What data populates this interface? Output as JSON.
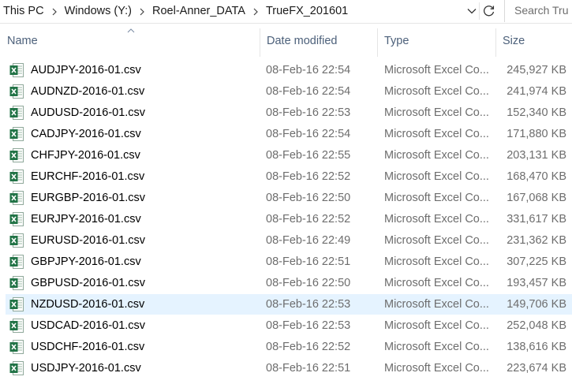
{
  "address_bar": {
    "crumbs": [
      "This PC",
      "Windows (Y:)",
      "Roel-Anner_DATA",
      "TrueFX_201601"
    ]
  },
  "search": {
    "placeholder": "Search Tru"
  },
  "columns": {
    "name": "Name",
    "date": "Date modified",
    "type": "Type",
    "size": "Size"
  },
  "files": [
    {
      "name": "AUDJPY-2016-01.csv",
      "date": "08-Feb-16 22:54",
      "type": "Microsoft Excel Co...",
      "size": "245,927 KB"
    },
    {
      "name": "AUDNZD-2016-01.csv",
      "date": "08-Feb-16 22:54",
      "type": "Microsoft Excel Co...",
      "size": "241,974 KB"
    },
    {
      "name": "AUDUSD-2016-01.csv",
      "date": "08-Feb-16 22:53",
      "type": "Microsoft Excel Co...",
      "size": "152,340 KB"
    },
    {
      "name": "CADJPY-2016-01.csv",
      "date": "08-Feb-16 22:54",
      "type": "Microsoft Excel Co...",
      "size": "171,880 KB"
    },
    {
      "name": "CHFJPY-2016-01.csv",
      "date": "08-Feb-16 22:55",
      "type": "Microsoft Excel Co...",
      "size": "203,131 KB"
    },
    {
      "name": "EURCHF-2016-01.csv",
      "date": "08-Feb-16 22:52",
      "type": "Microsoft Excel Co...",
      "size": "168,470 KB"
    },
    {
      "name": "EURGBP-2016-01.csv",
      "date": "08-Feb-16 22:50",
      "type": "Microsoft Excel Co...",
      "size": "167,068 KB"
    },
    {
      "name": "EURJPY-2016-01.csv",
      "date": "08-Feb-16 22:52",
      "type": "Microsoft Excel Co...",
      "size": "331,617 KB"
    },
    {
      "name": "EURUSD-2016-01.csv",
      "date": "08-Feb-16 22:49",
      "type": "Microsoft Excel Co...",
      "size": "231,362 KB"
    },
    {
      "name": "GBPJPY-2016-01.csv",
      "date": "08-Feb-16 22:51",
      "type": "Microsoft Excel Co...",
      "size": "307,225 KB"
    },
    {
      "name": "GBPUSD-2016-01.csv",
      "date": "08-Feb-16 22:50",
      "type": "Microsoft Excel Co...",
      "size": "193,457 KB"
    },
    {
      "name": "NZDUSD-2016-01.csv",
      "date": "08-Feb-16 22:53",
      "type": "Microsoft Excel Co...",
      "size": "149,706 KB",
      "selected": true
    },
    {
      "name": "USDCAD-2016-01.csv",
      "date": "08-Feb-16 22:53",
      "type": "Microsoft Excel Co...",
      "size": "252,048 KB"
    },
    {
      "name": "USDCHF-2016-01.csv",
      "date": "08-Feb-16 22:52",
      "type": "Microsoft Excel Co...",
      "size": "138,616 KB"
    },
    {
      "name": "USDJPY-2016-01.csv",
      "date": "08-Feb-16 22:51",
      "type": "Microsoft Excel Co...",
      "size": "223,674 KB"
    }
  ],
  "icons": {
    "file": "excel-csv-icon",
    "address_dropdown": "chevron-down-icon",
    "refresh": "refresh-icon",
    "sort": "sort-ascending-icon",
    "breadcrumb_separator": "chevron-right-icon"
  },
  "colors": {
    "excel_green": "#217346",
    "selected_row": "#e5f3ff",
    "header_text": "#4c607a",
    "secondary_text": "#6d6d6d"
  }
}
